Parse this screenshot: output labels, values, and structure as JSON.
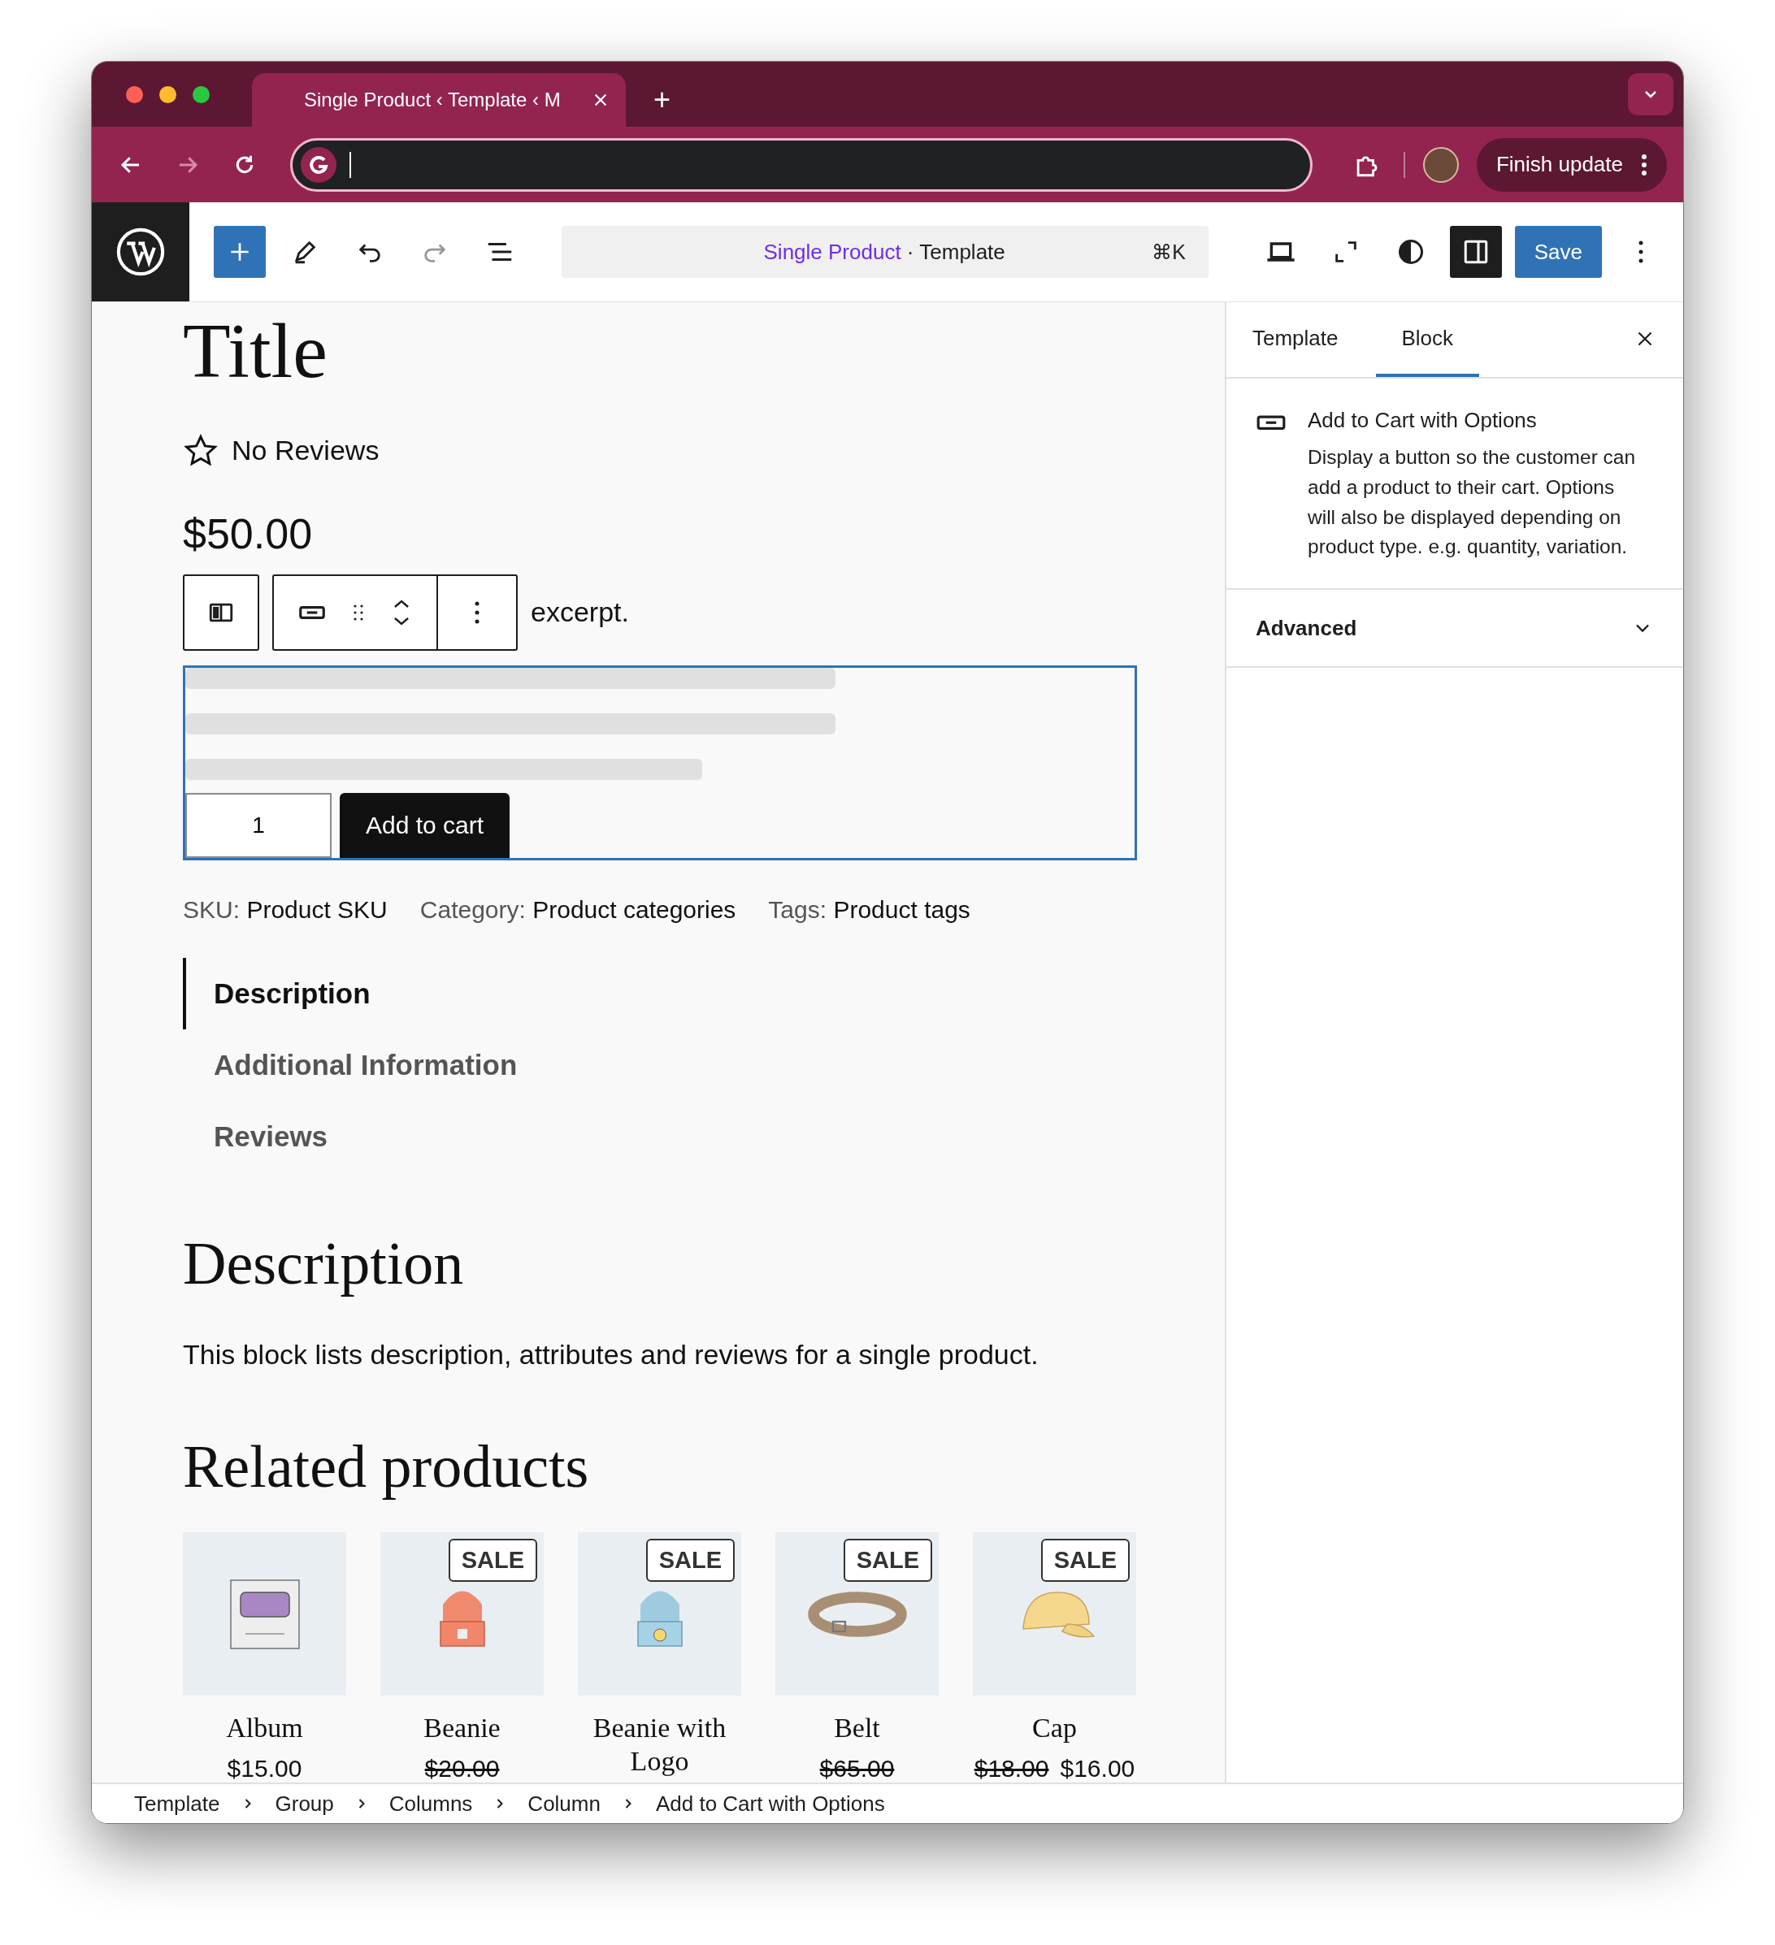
{
  "browser": {
    "tabs": [
      {
        "title": "Single Product ‹ Template ‹ M",
        "selected": true
      }
    ],
    "new_tab": "+",
    "profile_button": "Finish update"
  },
  "editor_toolbar": {
    "document_title": "Single Product",
    "document_type": "· Template",
    "shortcut": "⌘K",
    "save": "Save",
    "sidebar_open": true
  },
  "canvas": {
    "title": "Title",
    "rating_text": "No Reviews",
    "price": "$50.00",
    "excerpt": "excerpt.",
    "quantity": "1",
    "add_to_cart": "Add to cart",
    "meta": [
      {
        "label": "SKU:",
        "value": "Product SKU"
      },
      {
        "label": "Category:",
        "value": "Product categories"
      },
      {
        "label": "Tags:",
        "value": "Product tags"
      }
    ],
    "tabs": [
      {
        "label": "Description",
        "selected": true
      },
      {
        "label": "Additional Information",
        "selected": false
      },
      {
        "label": "Reviews",
        "selected": false
      }
    ],
    "description_heading": "Description",
    "description_text": "This block lists description, attributes and reviews for a single product.",
    "related_heading": "Related products",
    "products": [
      {
        "name": "Album",
        "kind": "album",
        "prices": [
          {
            "text": "$15.00",
            "struck": false
          }
        ]
      },
      {
        "name": "Beanie",
        "kind": "beanie",
        "badge": "SALE",
        "prices": [
          {
            "text": "$20.00",
            "struck": true
          }
        ]
      },
      {
        "name": "Beanie with Logo",
        "kind": "beanie-logo",
        "badge": "SALE"
      },
      {
        "name": "Belt",
        "kind": "belt",
        "badge": "SALE",
        "prices": [
          {
            "text": "$65.00",
            "struck": true
          }
        ]
      },
      {
        "name": "Cap",
        "kind": "cap",
        "badge": "SALE",
        "prices": [
          {
            "text": "$18.00",
            "struck": true
          },
          {
            "text": "$16.00",
            "struck": false
          }
        ]
      }
    ]
  },
  "sidebar": {
    "tabs": [
      {
        "label": "Template",
        "selected": false
      },
      {
        "label": "Block",
        "selected": true
      }
    ],
    "block_title": "Add to Cart with Options",
    "block_description": "Display a button so the customer can add a product to their cart. Options will also be displayed depending on product type. e.g. quantity, variation.",
    "panels": [
      {
        "label": "Advanced",
        "expanded": false
      }
    ]
  },
  "breadcrumb": [
    "Template",
    "Group",
    "Columns",
    "Column",
    "Add to Cart with Options"
  ]
}
